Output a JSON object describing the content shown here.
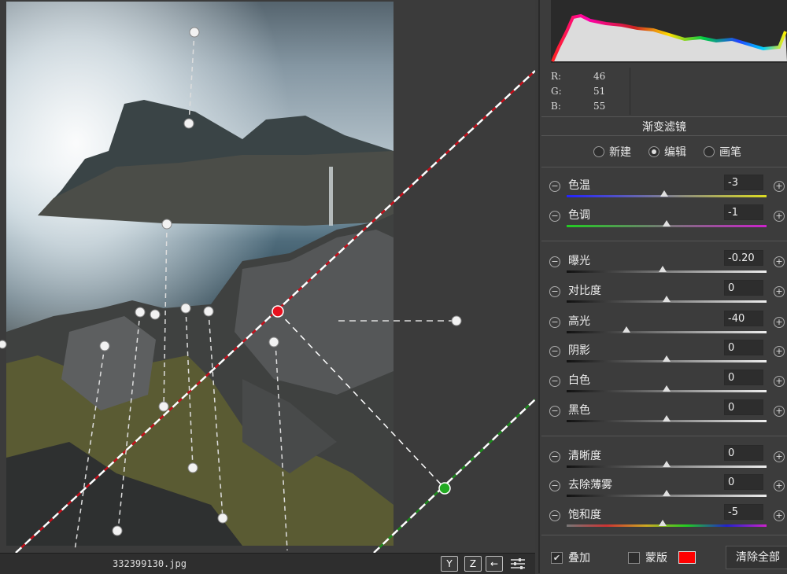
{
  "photo": {
    "filename": "332399130.jpg"
  },
  "statusbar": {
    "buttons": [
      "Y",
      "Z",
      "←"
    ]
  },
  "rgb": [
    {
      "label": "R:",
      "value": "46"
    },
    {
      "label": "G:",
      "value": "51"
    },
    {
      "label": "B:",
      "value": "55"
    }
  ],
  "panel": {
    "title": "渐变滤镜",
    "modes": [
      {
        "label": "新建",
        "selected": false
      },
      {
        "label": "编辑",
        "selected": true
      },
      {
        "label": "画笔",
        "selected": false
      }
    ]
  },
  "sliders": [
    {
      "label": "色温",
      "value": "-3",
      "position": 0.49
    },
    {
      "label": "色调",
      "value": "-1",
      "position": 0.5
    },
    {
      "label": "曝光",
      "value": "-0.20",
      "position": 0.48
    },
    {
      "label": "对比度",
      "value": "0",
      "position": 0.5
    },
    {
      "label": "高光",
      "value": "-40",
      "position": 0.3
    },
    {
      "label": "阴影",
      "value": "0",
      "position": 0.5
    },
    {
      "label": "白色",
      "value": "0",
      "position": 0.5
    },
    {
      "label": "黑色",
      "value": "0",
      "position": 0.5
    },
    {
      "label": "清晰度",
      "value": "0",
      "position": 0.5
    },
    {
      "label": "去除薄雾",
      "value": "0",
      "position": 0.5
    },
    {
      "label": "饱和度",
      "value": "-5",
      "position": 0.48
    }
  ],
  "footer": {
    "overlay_label": "叠加",
    "overlay_checked": true,
    "mask_label": "蒙版",
    "mask_checked": false,
    "mask_color": "#ff0000",
    "clear_label": "清除全部"
  },
  "colors": {
    "red_pin": "#e8101e",
    "green_pin": "#22aa22",
    "panel_bg": "#3c3c3c"
  }
}
